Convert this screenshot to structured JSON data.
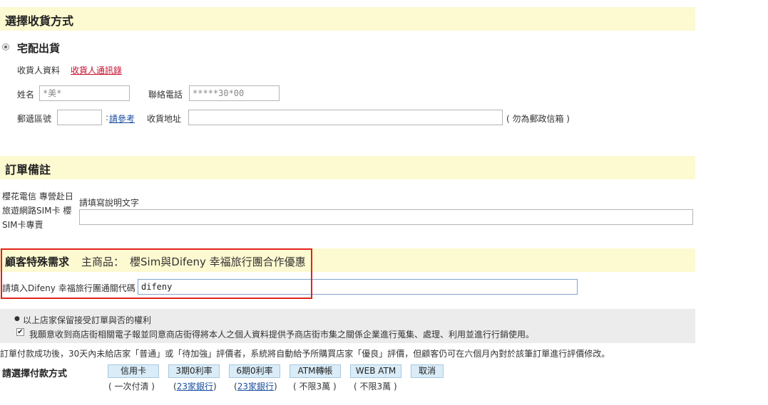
{
  "delivery": {
    "section_title": "選擇收貨方式",
    "option_label": "宅配出貨",
    "recipient_label": "收貨人資料",
    "address_book_link": "收貨人通訊錄",
    "name_label": "姓名",
    "name_value": "*美*",
    "phone_label": "聯絡電話",
    "phone_value": "*****30*00",
    "zip_label": "郵遞區號",
    "zip_value": "",
    "zip_ref_link": "請參考",
    "address_label": "收貨地址",
    "address_value": "",
    "address_note": "( 勿為郵政信箱 )"
  },
  "order_notes": {
    "section_title": "訂單備註",
    "product_name": "櫻花電信 專營赴日旅遊網路SIM卡 櫻SIM卡專賣",
    "instruction": "請填寫說明文字",
    "note_value": ""
  },
  "special": {
    "section_title": "顧客特殊需求",
    "main_product_label": "主商品：",
    "main_product_name": "櫻Sim與Difeny 幸福旅行團合作優惠",
    "code_label": "請填入Difeny 幸福旅行團通關代碼",
    "code_value": "difeny"
  },
  "agreements": {
    "bullet_text": "以上店家保留接受訂單與否的權利",
    "consent_checked": true,
    "consent_text": "我願意收到商店街相關電子報並同意商店街得將本人之個人資料提供予商店街市集之關係企業進行蒐集、處理、利用並進行行銷使用。"
  },
  "rating_notice": "訂單付款成功後，30天內未給店家「普通」或「待加強」評價者，系統將自動給予所購買店家「優良」評價，但顧客仍可在六個月內對於該筆訂單進行評價修改。",
  "payment": {
    "label": "請選擇付款方式",
    "buttons": [
      {
        "label": "信用卡",
        "note": "( 一次付清 )"
      },
      {
        "label": "3期0利率",
        "note_pre": "(",
        "note_link": "23家銀行",
        "note_post": ")"
      },
      {
        "label": "6期0利率",
        "note_pre": "(",
        "note_link": "23家銀行",
        "note_post": ")"
      },
      {
        "label": "ATM轉帳",
        "note": "( 不限3萬 )"
      },
      {
        "label": "WEB ATM",
        "note": "( 不限3萬 )"
      },
      {
        "label": "取消"
      }
    ]
  },
  "colors": {
    "section_bg": "#fdf9d0",
    "highlight_border": "#e2231a",
    "link_red": "#c8102e",
    "link_blue": "#1a4fa0",
    "button_bg": "#d9ecf8",
    "focus_border": "#7fa6cf"
  }
}
